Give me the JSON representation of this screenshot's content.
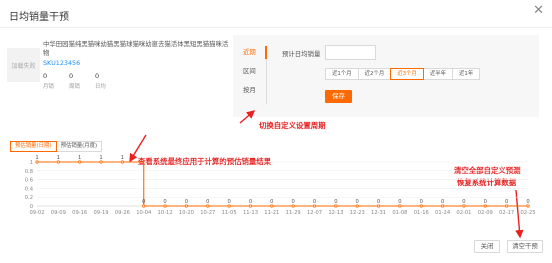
{
  "dialog": {
    "title": "日均销量干预",
    "close_glyph": "✕"
  },
  "product": {
    "image_placeholder": "加载失败",
    "name": "中华田园猫纯黑猫咪幼猫黑猫球猫咪幼崽去猫活体黑短黑猫猫咪活物",
    "sku": "SKU123456",
    "stats": [
      {
        "value": "0",
        "label": "月销"
      },
      {
        "value": "0",
        "label": "周销"
      },
      {
        "value": "0",
        "label": "日均"
      }
    ]
  },
  "settings": {
    "tabs": [
      "近期",
      "区间",
      "按月"
    ],
    "active_tab": "近期",
    "field_label": "预计日均销量",
    "field_value": "",
    "period_options": [
      "近1个月",
      "近2个月",
      "近3个月",
      "近半年",
      "近1年"
    ],
    "selected_period": "近3个月",
    "save_label": "保存"
  },
  "annotations": {
    "switch_period": "切换自定义设置周期",
    "view_result": "查看系统最终应用于计算的预估销量结果",
    "clear_line1": "清空全部自定义预测",
    "clear_line2": "恢复系统计算数据"
  },
  "chart_toggle": [
    "预估销量(日期)",
    "预估销量(月度)"
  ],
  "chart_data": {
    "type": "line",
    "categories": [
      "09-02",
      "09-09",
      "09-16",
      "09-19",
      "09-26",
      "10-04",
      "10-12",
      "10-20",
      "10-27",
      "11-05",
      "11-13",
      "11-21",
      "11-29",
      "12-07",
      "12-13",
      "12-23",
      "12-31",
      "01-08",
      "01-16",
      "01-24",
      "02-01",
      "02-09",
      "02-17",
      "02-25"
    ],
    "series": [
      {
        "values": [
          1,
          1,
          1,
          1,
          1,
          0,
          0,
          0,
          0,
          0,
          0,
          0,
          0,
          0,
          0,
          0,
          0,
          0,
          0,
          0,
          0,
          0,
          0,
          0
        ]
      }
    ],
    "data_labels": [
      "1",
      "1",
      "1",
      "1",
      "1",
      "0",
      "0",
      "0",
      "0",
      "0",
      "0",
      "0",
      "0",
      "0",
      "0",
      "0",
      "0",
      "0",
      "0",
      "0",
      "0",
      "0",
      "0",
      "0"
    ],
    "y_ticks": [
      "0",
      "0.2",
      "0.4",
      "0.6",
      "0.8",
      "1"
    ],
    "ylim": [
      0,
      1
    ],
    "color": "#ff6a00",
    "grid": true
  },
  "footer": {
    "close_label": "关闭",
    "clear_label": "清空干预"
  },
  "colors": {
    "accent": "#ff6a00",
    "annotation": "#e82020",
    "link": "#1a8cff"
  }
}
